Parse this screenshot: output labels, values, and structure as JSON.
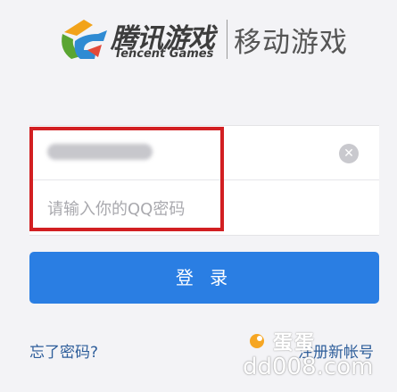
{
  "header": {
    "brand_cn": "腾讯游戏",
    "brand_en": "Tencent Games",
    "section_title": "移动游戏"
  },
  "login_form": {
    "account_value": "",
    "clear_icon": "close-circle-icon",
    "password_placeholder": "请输入你的QQ密码",
    "login_label": "登 录",
    "forgot_label": "忘了密码?",
    "register_label": "注册新帐号"
  },
  "watermark": {
    "text": "蛋蛋",
    "domain": "dd008.com"
  },
  "colors": {
    "primary": "#2a7ee3",
    "highlight": "#d21f22",
    "link": "#2d5d9a",
    "background": "#f3f3f6"
  }
}
